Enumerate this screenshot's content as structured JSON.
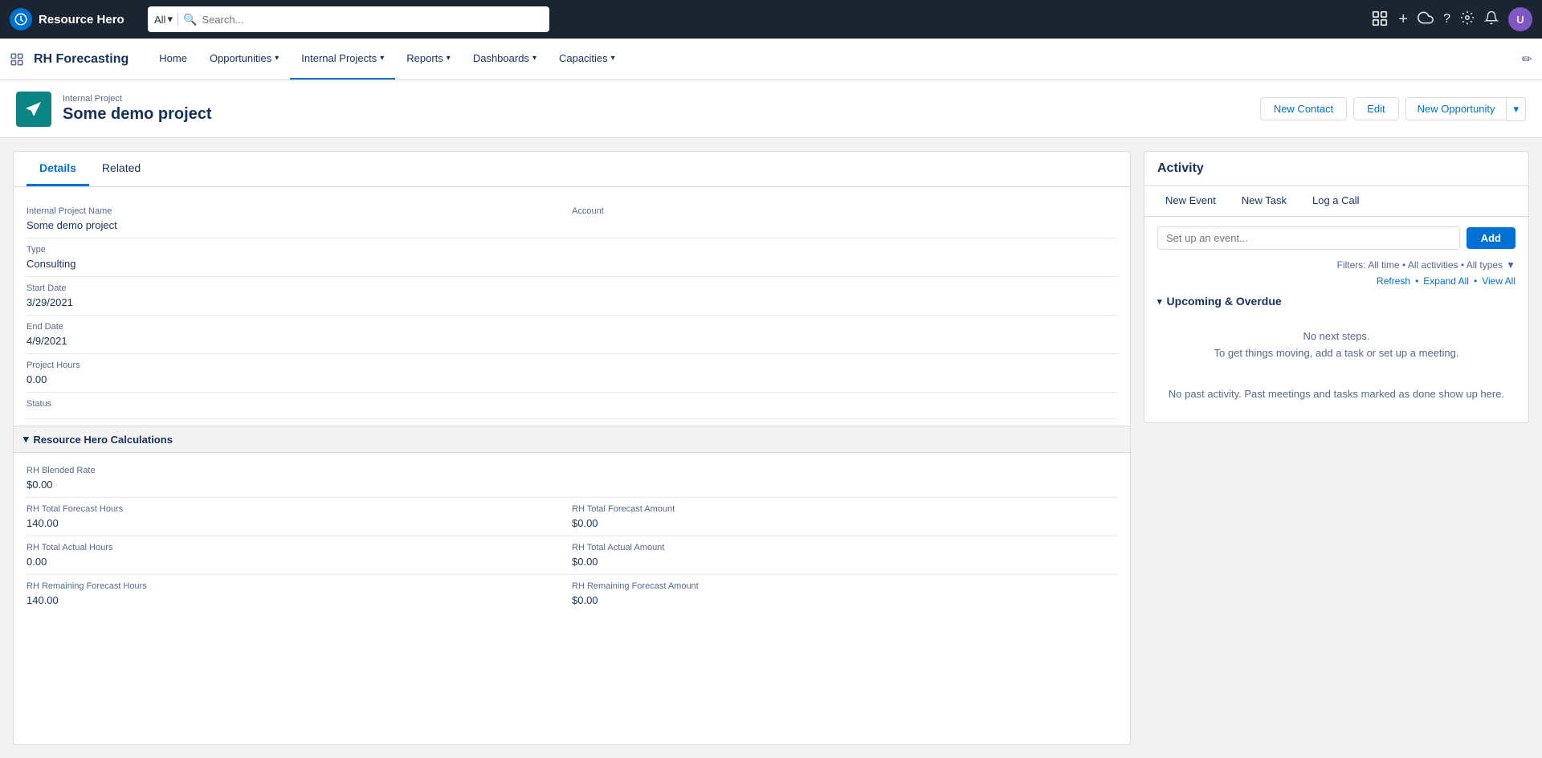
{
  "topNav": {
    "logo": "Resource Hero",
    "logoIconText": "⏱",
    "searchPlaceholder": "Search...",
    "searchScope": "All",
    "actions": {
      "favorite": "★",
      "add": "+",
      "cloud": "☁",
      "help": "?",
      "settings": "⚙",
      "notifications": "🔔"
    }
  },
  "appNav": {
    "appName": "RH Forecasting",
    "navItems": [
      {
        "label": "Home",
        "hasDropdown": false
      },
      {
        "label": "Opportunities",
        "hasDropdown": true
      },
      {
        "label": "Internal Projects",
        "hasDropdown": true
      },
      {
        "label": "Reports",
        "hasDropdown": true
      },
      {
        "label": "Dashboards",
        "hasDropdown": true
      },
      {
        "label": "Capacities",
        "hasDropdown": true
      }
    ]
  },
  "recordHeader": {
    "recordType": "Internal Project",
    "recordName": "Some demo project",
    "iconSymbol": "✈",
    "actions": {
      "newContact": "New Contact",
      "edit": "Edit",
      "newOpportunity": "New Opportunity"
    }
  },
  "detailTabs": [
    {
      "label": "Details",
      "active": true
    },
    {
      "label": "Related",
      "active": false
    }
  ],
  "fields": {
    "internalProjectName": {
      "label": "Internal Project Name",
      "value": "Some demo project"
    },
    "account": {
      "label": "Account",
      "value": ""
    },
    "type": {
      "label": "Type",
      "value": "Consulting"
    },
    "startDate": {
      "label": "Start Date",
      "value": "3/29/2021"
    },
    "endDate": {
      "label": "End Date",
      "value": "4/9/2021"
    },
    "projectHours": {
      "label": "Project Hours",
      "value": "0.00"
    },
    "status": {
      "label": "Status",
      "value": ""
    }
  },
  "rhCalculations": {
    "sectionTitle": "Resource Hero Calculations",
    "blendedRate": {
      "label": "RH Blended Rate",
      "value": "$0.00"
    },
    "totalForecastHours": {
      "label": "RH Total Forecast Hours",
      "value": "140.00"
    },
    "totalForecastAmount": {
      "label": "RH Total Forecast Amount",
      "value": "$0.00"
    },
    "totalActualHours": {
      "label": "RH Total Actual Hours",
      "value": "0.00"
    },
    "totalActualAmount": {
      "label": "RH Total Actual Amount",
      "value": "$0.00"
    },
    "remainingForecastHours": {
      "label": "RH Remaining Forecast Hours",
      "value": "140.00"
    },
    "remainingForecastAmount": {
      "label": "RH Remaining Forecast Amount",
      "value": "$0.00"
    }
  },
  "activity": {
    "title": "Activity",
    "tabs": [
      {
        "label": "New Event",
        "active": false
      },
      {
        "label": "New Task",
        "active": false
      },
      {
        "label": "Log a Call",
        "active": false
      }
    ],
    "inputPlaceholder": "Set up an event...",
    "addButton": "Add",
    "filters": "Filters: All time • All activities • All types",
    "filterIcon": "▼",
    "refreshLink": "Refresh",
    "expandAllLink": "Expand All",
    "viewAllLink": "View All",
    "upcomingHeader": "Upcoming & Overdue",
    "noNextSteps": "No next steps.",
    "noNextStepsHint": "To get things moving, add a task or set up a meeting.",
    "noPastActivity": "No past activity. Past meetings and tasks marked as done show up here."
  }
}
